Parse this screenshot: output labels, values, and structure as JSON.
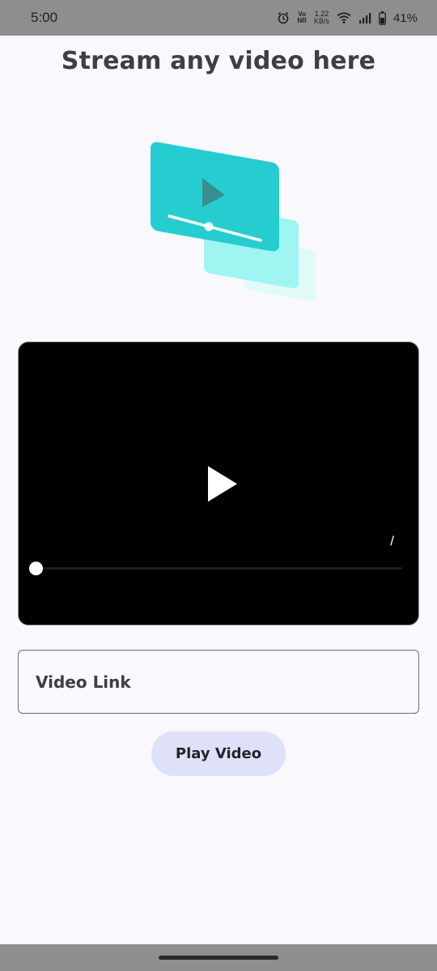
{
  "status_bar": {
    "time": "5:00",
    "volte_top": "Vo",
    "volte_bottom": "NR",
    "net_speed_value": "1.22",
    "net_speed_unit": "KB/s",
    "battery_percent": "41%",
    "icons": [
      "alarm-icon",
      "volte-icon",
      "wifi-icon",
      "signal-icon",
      "battery-icon"
    ]
  },
  "page": {
    "title": "Stream any video here"
  },
  "illustration": {
    "icon": "video-stack-icon",
    "colors": {
      "front": "#26cdd0",
      "middle": "#9ef5f2",
      "back": "#dffaf9",
      "play": "#3a8e8f"
    }
  },
  "player": {
    "time_display": "/",
    "progress": 0,
    "controls": [
      "play-icon",
      "seek-bar"
    ]
  },
  "input": {
    "placeholder": "Video Link",
    "value": ""
  },
  "button": {
    "label": "Play Video"
  },
  "colors": {
    "background": "#f8f8fd",
    "title": "#3c3f48",
    "button_bg": "#dfe1f8",
    "system_bar": "#8e8e8e"
  }
}
